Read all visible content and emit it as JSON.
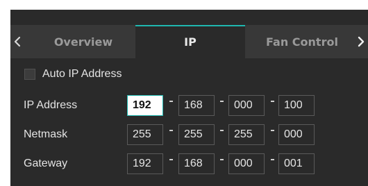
{
  "tabs": {
    "prev_arrow": "‹",
    "next_arrow": "›",
    "items": [
      {
        "label": "Overview",
        "active": false
      },
      {
        "label": "IP",
        "active": true
      },
      {
        "label": "Fan Control",
        "active": false
      }
    ]
  },
  "auto_ip": {
    "label": "Auto IP Address",
    "checked": false
  },
  "fields": {
    "ip_address": {
      "label": "IP Address",
      "octets": [
        "192",
        "168",
        "000",
        "100"
      ]
    },
    "netmask": {
      "label": "Netmask",
      "octets": [
        "255",
        "255",
        "255",
        "000"
      ]
    },
    "gateway": {
      "label": "Gateway",
      "octets": [
        "192",
        "168",
        "000",
        "001"
      ]
    }
  },
  "colors": {
    "accent": "#1fb8b0",
    "panel_bg": "#2a2a2a",
    "tabbar_bg": "#383838"
  }
}
